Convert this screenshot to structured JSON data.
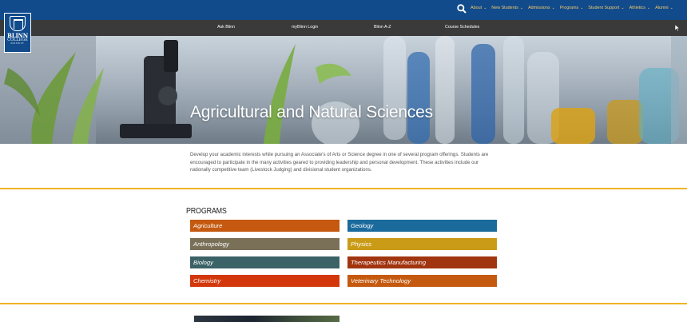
{
  "header": {
    "logo": {
      "line1": "BLINN",
      "line2": "COLLEGE",
      "line3": "DISTRICT"
    },
    "search_icon": "search-icon",
    "nav": [
      {
        "label": "About"
      },
      {
        "label": "New Students"
      },
      {
        "label": "Admissions"
      },
      {
        "label": "Programs"
      },
      {
        "label": "Student Support"
      },
      {
        "label": "Athletics"
      },
      {
        "label": "Alumni"
      }
    ],
    "quick_links": [
      "Ask Blinn",
      "myBlinn Login",
      "Blinn A-Z",
      "Course Schedules"
    ]
  },
  "hero": {
    "title": "Agricultural and Natural Sciences"
  },
  "intro": {
    "text": "Develop your academic interests while pursuing an Associate's of Arts or Science degree in one of several program offerings. Students are encouraged to participate in the many activities geared to providing leadership and personal development. These activities include our nationally competitive team (Livestock Judging) and divisional student organizations."
  },
  "programs": {
    "heading": "PROGRAMS",
    "left": [
      {
        "label": "Agriculture",
        "color": "#c4590f"
      },
      {
        "label": "Anthropology",
        "color": "#7a7058"
      },
      {
        "label": "Biology",
        "color": "#3b6266"
      },
      {
        "label": "Chemistry",
        "color": "#d2380c"
      }
    ],
    "right": [
      {
        "label": "Geology",
        "color": "#1a6a9c"
      },
      {
        "label": "Physics",
        "color": "#c99b16"
      },
      {
        "label": "Therapeutics Manufacturing",
        "color": "#a1350f"
      },
      {
        "label": "Veterinary Technology",
        "color": "#c4590f"
      }
    ]
  },
  "colors": {
    "topbar": "#114b8c",
    "subbar": "#3a3a3a",
    "nav_text": "#f3c969",
    "divider": "#f0b323"
  }
}
